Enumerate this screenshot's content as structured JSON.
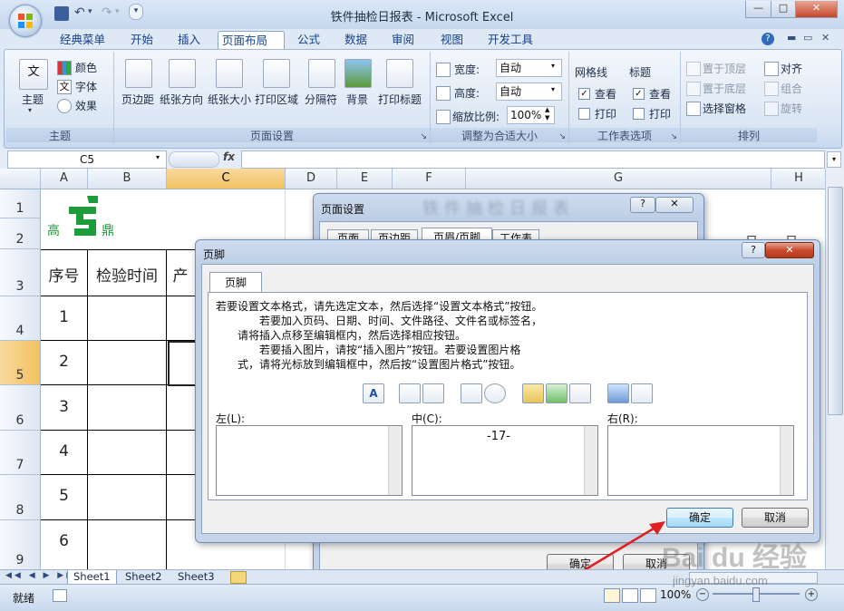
{
  "window": {
    "title": "铁件抽检日报表 - Microsoft Excel",
    "controls": [
      "—",
      "□",
      "✕"
    ]
  },
  "ribbon_tabs": [
    "经典菜单",
    "开始",
    "插入",
    "页面布局",
    "公式",
    "数据",
    "审阅",
    "视图",
    "开发工具"
  ],
  "active_tab": "页面布局",
  "ribbon": {
    "theme_group": {
      "label": "主题",
      "big": "主题",
      "colors": "颜色",
      "fonts": "字体",
      "effects": "效果"
    },
    "page_setup_group": {
      "label": "页面设置",
      "buttons": [
        "页边距",
        "纸张方向",
        "纸张大小",
        "打印区域",
        "分隔符",
        "背景",
        "打印标题"
      ]
    },
    "scale_group": {
      "label": "调整为合适大小",
      "width_label": "宽度:",
      "width_value": "自动",
      "height_label": "高度:",
      "height_value": "自动",
      "scale_label": "缩放比例:",
      "scale_value": "100%"
    },
    "sheet_options_group": {
      "label": "工作表选项",
      "gridlines": "网格线",
      "headings": "标题",
      "view": "查看",
      "print": "打印"
    },
    "arrange_group": {
      "label": "排列",
      "bring_front": "置于顶层",
      "send_back": "置于底层",
      "selection_pane": "选择窗格",
      "align": "对齐",
      "group": "组合",
      "rotate": "旋转"
    }
  },
  "formula_bar": {
    "name_box": "C5",
    "fx": "fx",
    "value": ""
  },
  "columns": [
    "A",
    "B",
    "C",
    "D",
    "E",
    "F",
    "G",
    "H"
  ],
  "selected_column": "C",
  "rows": [
    "1",
    "2",
    "3",
    "4",
    "5",
    "6",
    "7",
    "8",
    "9"
  ],
  "selected_row": "5",
  "sheet": {
    "logo_left": "高",
    "logo_right": "鼎",
    "header_seq": "序号",
    "header_time": "检验时间",
    "header_prod": "产",
    "seq_values": [
      "1",
      "2",
      "3",
      "4",
      "5",
      "6"
    ]
  },
  "page_setup_dialog": {
    "title": "页面设置",
    "blurred_title": "铁件抽检日报表",
    "tabs": [
      "页面",
      "页边距",
      "页眉/页脚",
      "工作表"
    ],
    "ok": "确定",
    "cancel": "取消"
  },
  "footer_dialog": {
    "title": "页脚",
    "tab": "页脚",
    "instructions": [
      "若要设置文本格式，请先选定文本，然后选择“设置文本格式”按钮。",
      "若要加入页码、日期、时间、文件路径、文件名或标签名，",
      "请将插入点移至编辑框内，然后选择相应按钮。",
      "若要插入图片，请按“插入图片”按钮。若要设置图片格",
      "式，请将光标放到编辑框中，然后按“设置图片格式”按钮。"
    ],
    "left_label": "左(L):",
    "center_label": "中(C):",
    "right_label": "右(R):",
    "center_value": "-17-",
    "ok": "确定",
    "cancel": "取消"
  },
  "sheet_tabs": [
    "Sheet1",
    "Sheet2",
    "Sheet3"
  ],
  "status": {
    "ready": "就绪",
    "zoom": "100%"
  },
  "watermark": {
    "brand": "Bai du 经验",
    "url": "jingyan.baidu.com"
  },
  "colors": {
    "accent_blue": "#15428b",
    "selected_header": "#f1c15f",
    "annotation_arrow": "#e02020",
    "logo_green": "#1e9b3a"
  }
}
